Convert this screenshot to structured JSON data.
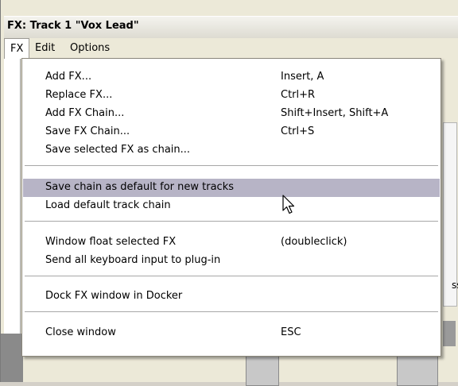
{
  "window": {
    "title": "FX: Track 1 \"Vox Lead\""
  },
  "menubar": {
    "items": [
      {
        "label": "FX"
      },
      {
        "label": "Edit"
      },
      {
        "label": "Options"
      }
    ]
  },
  "fx_menu": {
    "groups": [
      [
        {
          "label": "Add FX...",
          "shortcut": "Insert, A"
        },
        {
          "label": "Replace FX...",
          "shortcut": "Ctrl+R"
        },
        {
          "label": "Add FX Chain...",
          "shortcut": "Shift+Insert, Shift+A"
        },
        {
          "label": "Save FX Chain...",
          "shortcut": "Ctrl+S"
        },
        {
          "label": "Save selected FX as chain...",
          "shortcut": ""
        }
      ],
      [
        {
          "label": "Save chain as default for new tracks",
          "shortcut": "",
          "highlighted": true
        },
        {
          "label": "Load default track chain",
          "shortcut": ""
        }
      ],
      [
        {
          "label": "Window float selected FX",
          "shortcut": "(doubleclick)"
        },
        {
          "label": "Send all keyboard input to plug-in",
          "shortcut": ""
        }
      ],
      [
        {
          "label": "Dock FX window in Docker",
          "shortcut": ""
        }
      ],
      [
        {
          "label": "Close window",
          "shortcut": "ESC"
        }
      ]
    ]
  },
  "background": {
    "edge_text": "ss"
  },
  "colors": {
    "menu_highlight": "#b7b4c6",
    "separator": "#a7a7a7"
  },
  "cursor": {
    "icon": "arrow-cursor-icon"
  }
}
